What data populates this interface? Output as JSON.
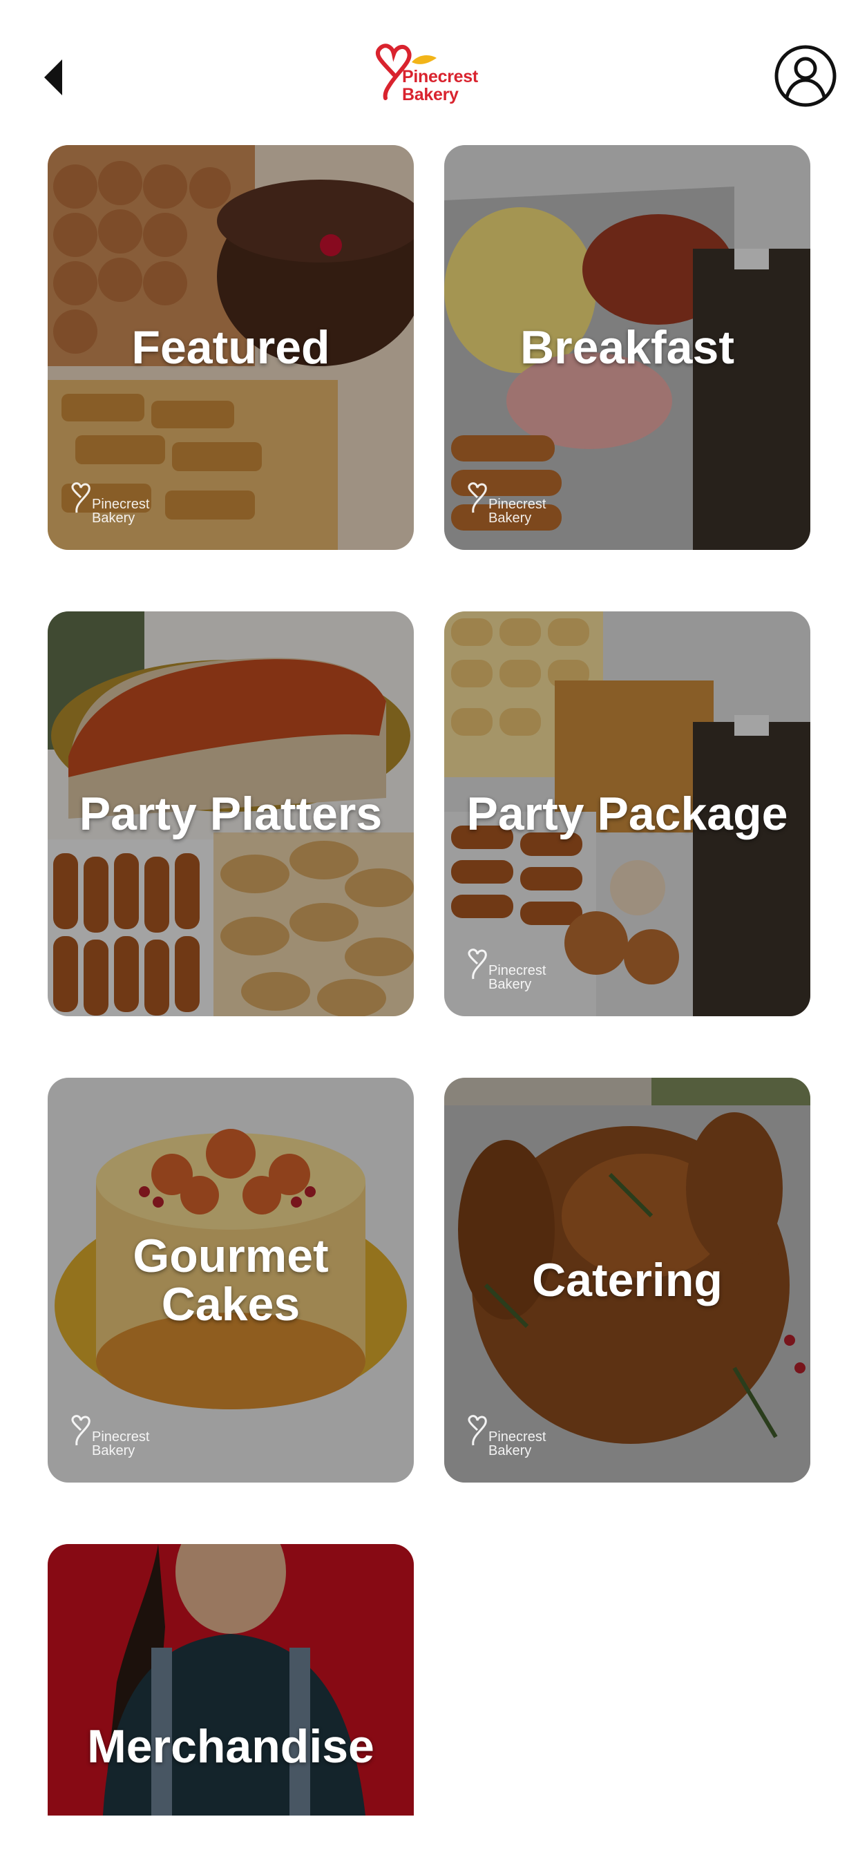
{
  "header": {
    "back_icon": "back-arrow-icon",
    "logo_line1": "Pinecrest",
    "logo_line2": "Bakery",
    "profile_icon": "user-profile-icon"
  },
  "watermark": {
    "line1": "Pinecrest",
    "line2": "Bakery"
  },
  "colors": {
    "brand_red": "#d9232e",
    "brand_yellow": "#f2b418",
    "overlay": "rgba(0,0,0,0.32)",
    "label_text": "#ffffff"
  },
  "categories": [
    {
      "label": "Featured"
    },
    {
      "label": "Breakfast"
    },
    {
      "label": "Party Platters"
    },
    {
      "label": "Party Package"
    },
    {
      "label": "Gourmet Cakes"
    },
    {
      "label": "Catering"
    },
    {
      "label": "Merchandise"
    }
  ]
}
